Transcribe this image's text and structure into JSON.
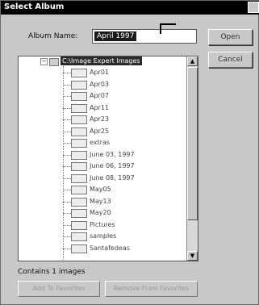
{
  "window": {
    "title": "Select Album"
  },
  "form": {
    "album_name_label": "Album Name:",
    "album_name_value": "April 1997"
  },
  "buttons": {
    "open": "Open",
    "cancel": "Cancel",
    "add_to_favorites": "Add To Favorites",
    "remove_from_favorites": "Remove From Favorites"
  },
  "tree": {
    "root": "C:\\Image Expert Images",
    "items": [
      "Apr01",
      "Apr03",
      "Apr07",
      "Apr11",
      "Apr23",
      "Apr25",
      "extras",
      "June 03, 1997",
      "June 06, 1997",
      "June 08, 1997",
      "May05",
      "May13",
      "May20",
      "Pictures",
      "samples",
      "Santafedeas"
    ]
  },
  "status": {
    "contains": "Contains 1 images"
  }
}
